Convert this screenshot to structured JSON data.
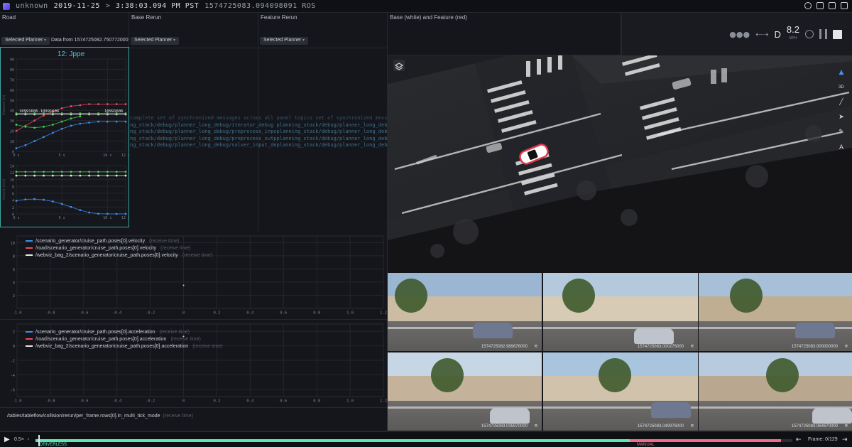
{
  "topbar": {
    "source": "unknown",
    "date": "2019-11-25",
    "arrow": ">",
    "time": "3:38:03.094 PM PST",
    "ros_time": "1574725083.094098091 ROS"
  },
  "panels": {
    "road": {
      "title": "Road",
      "planner": "Selected Planner",
      "data_from": "Data from 1574725082.750772000"
    },
    "base": {
      "title": "Base Rerun",
      "planner": "Selected Planner"
    },
    "feature": {
      "title": "Feature Rerun",
      "planner": "Selected Planner"
    },
    "map": {
      "title": "Base (white) and Feature (red)"
    }
  },
  "chart_data": [
    {
      "type": "scatter",
      "title": "12: Jppe",
      "ylabel": "Distance [m]",
      "yticks": [
        "90",
        "80",
        "70",
        "60",
        "50",
        "40",
        "30",
        "20",
        "10",
        "0"
      ],
      "xticks": [
        "0 s",
        "5 s",
        "10 s",
        "12 s"
      ],
      "xlim": [
        0,
        12
      ],
      "ylim": [
        0,
        90
      ],
      "annotations": [
        "10991606.10991606",
        "10991606"
      ],
      "series": [
        {
          "color": "#e8e8e8",
          "x": [
            0,
            1,
            2,
            3,
            4,
            5,
            6,
            7,
            8,
            9,
            10,
            11,
            12
          ],
          "y": [
            36,
            36,
            36,
            36,
            36,
            36,
            36,
            36,
            36,
            36,
            36,
            36,
            36
          ]
        },
        {
          "color": "#43d04b",
          "x": [
            0,
            1,
            2,
            3,
            4,
            5,
            6,
            7,
            8,
            9,
            10,
            11,
            12
          ],
          "y": [
            37,
            37,
            37,
            37,
            37,
            37,
            37,
            37,
            37,
            37,
            37,
            37,
            37
          ]
        },
        {
          "color": "#f0485c",
          "x": [
            0,
            1,
            2,
            3,
            4,
            5,
            6,
            7,
            8,
            9,
            10,
            11,
            12
          ],
          "y": [
            20,
            25,
            30,
            35,
            39,
            42,
            44,
            45,
            46,
            46,
            46,
            46,
            46
          ]
        },
        {
          "color": "#43d04b",
          "x": [
            0,
            1,
            2,
            3,
            4,
            5,
            6,
            7
          ],
          "y": [
            26,
            24,
            23,
            24,
            26,
            29,
            32,
            34
          ]
        },
        {
          "color": "#3f8ef0",
          "x": [
            0,
            1,
            2,
            3,
            4,
            5,
            6,
            7,
            8,
            9,
            10,
            11,
            12
          ],
          "y": [
            3,
            6,
            10,
            14,
            18,
            22,
            25,
            27,
            28,
            29,
            29,
            29,
            29
          ]
        }
      ]
    },
    {
      "type": "line",
      "ylabel": "Velocity [m/s]",
      "yticks": [
        "14",
        "12",
        "10",
        "8",
        "6",
        "4",
        "2",
        "0"
      ],
      "xticks": [
        "0 s",
        "5 s",
        "10 s",
        "12 s"
      ],
      "xlim": [
        0,
        12
      ],
      "ylim": [
        0,
        14
      ],
      "series": [
        {
          "color": "#43d04b",
          "x": [
            0,
            1,
            2,
            3,
            4,
            5,
            6,
            7,
            8,
            9,
            10,
            11,
            12
          ],
          "y": [
            12.2,
            12.2,
            12.2,
            12.2,
            12.2,
            12.2,
            12.2,
            12.2,
            12.2,
            12.2,
            12.2,
            12.2,
            12.2
          ]
        },
        {
          "color": "#e8e8e8",
          "x": [
            0,
            1,
            2,
            3,
            4,
            5,
            6,
            7,
            8,
            9,
            10,
            11,
            12
          ],
          "y": [
            11.1,
            11.1,
            11.1,
            11.1,
            11.1,
            11.1,
            11.1,
            11.1,
            11.1,
            11.1,
            11.1,
            11.1,
            11.1
          ]
        },
        {
          "color": "#3f8ef0",
          "x": [
            0,
            1,
            2,
            3,
            4,
            5,
            6,
            7,
            8,
            9,
            10,
            11,
            12
          ],
          "y": [
            3.8,
            4.2,
            4.3,
            4.1,
            3.6,
            2.9,
            2,
            1.1,
            0.4,
            0.05,
            0,
            0,
            0
          ]
        }
      ]
    },
    {
      "type": "line",
      "yticks": [
        "10",
        "8",
        "6",
        "4",
        "2"
      ],
      "xticks": [
        "-1.0",
        "-0.8",
        "-0.6",
        "-0.4",
        "-0.2",
        "0",
        "0.2",
        "0.4",
        "0.6",
        "0.8",
        "1.0",
        "1.2"
      ],
      "xlim": [
        -1,
        1.2
      ],
      "ylim": [
        0,
        11
      ],
      "legend": [
        {
          "name": "/scenario_generator/cruise_path.poses[0].velocity",
          "color": "#3f8ef0",
          "time": "(receive time)"
        },
        {
          "name": "/road/scenario_generator/cruise_path.poses[0].velocity",
          "color": "#f0485c",
          "time": "(receive time)"
        },
        {
          "name": "/webviz_bag_2/scenario_generator/cruise_path.poses[0].velocity",
          "color": "#e8e8e8",
          "time": "(receive time)"
        }
      ],
      "points": [
        {
          "x": 0,
          "y": 3.5
        }
      ]
    },
    {
      "type": "line",
      "yticks": [
        "2",
        "0",
        "-2",
        "-4",
        "-6"
      ],
      "xticks": [
        "-1.0",
        "-0.8",
        "-0.6",
        "-0.4",
        "-0.2",
        "0",
        "0.2",
        "0.4",
        "0.6",
        "0.8",
        "1.0",
        "1.2"
      ],
      "xlim": [
        -1,
        1.2
      ],
      "ylim": [
        -7,
        3
      ],
      "legend": [
        {
          "name": "/scenario_generator/cruise_path.poses[0].acceleration",
          "color": "#3f8ef0",
          "time": "(receive time)"
        },
        {
          "name": "/road/scenario_generator/cruise_path.poses[0].acceleration",
          "color": "#f0485c",
          "time": "(receive time)"
        },
        {
          "name": "/webviz_bag_2/scenario_generator/cruise_path.poses[0].acceleration",
          "color": "#e8e8e8",
          "time": "(receive time)"
        }
      ],
      "points": [
        {
          "x": 0,
          "y": 1.3
        }
      ]
    }
  ],
  "topic_lines": [
    "complete set of synchronized messages across all panel topics set of synchronized messages across all panel topics.",
    "ng_stack/debug/planner_long_debug/iterator_debug  planning_stack/debug/planner_long_debug/iterator_",
    "ng_stack/debug/planner_long_debug/preprocess_inpuplanning_stack/debug/planner_long_debug/preprocess_",
    "ng_stack/debug/planner_long_debug/preprocess_outpplanning_stack/debug/planner_long_debug/preprocess_",
    "ng_stack/debug/planner_long_debug/solver_input_deplanning_stack/debug/planner_long_debug/solver_in"
  ],
  "bottom_topic": {
    "name": "/tables/tableflow/collision/rerun/per_frame.rows[0].in_multi_tick_mode",
    "time": "(receive time)"
  },
  "hud": {
    "gear": "D",
    "speed": "8.2",
    "unit": "MPH"
  },
  "map_tools": [
    "layers-icon",
    "north-arrow-icon",
    "3d-icon",
    "ruler-icon",
    "select-icon",
    "pencil-icon",
    "text-icon"
  ],
  "cameras": [
    {
      "ts": "1574725082.989876000"
    },
    {
      "ts": "1574725083.000276000"
    },
    {
      "ts": "1574725083.000000000"
    },
    {
      "ts": "1574725083.035970000"
    },
    {
      "ts": "1574725083.049976000"
    },
    {
      "ts": "1574725083.064670000"
    }
  ],
  "timeline": {
    "speed": "0.5×",
    "frame": "Frame: 0/129",
    "label_left": "DRIVERLESS",
    "label_right": "MANUAL",
    "progress": 0.05,
    "colors": {
      "driverless": "#5fe6b5",
      "manual": "#f06d8c"
    }
  }
}
